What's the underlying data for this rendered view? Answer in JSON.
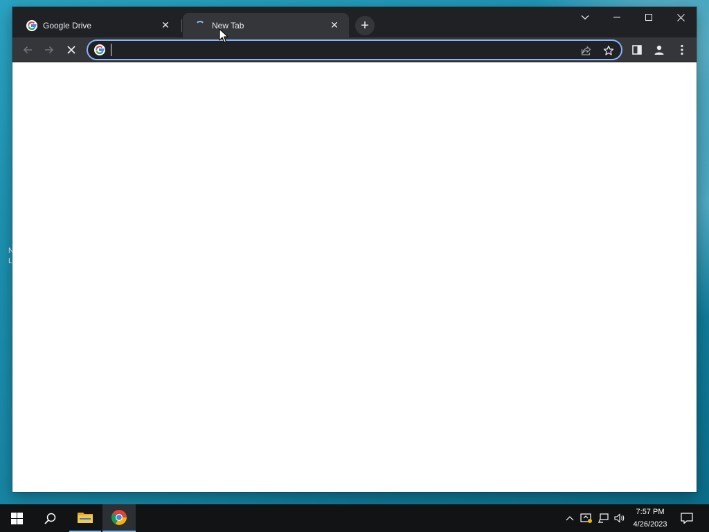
{
  "desktop": {
    "fragments": [
      "N",
      "L"
    ]
  },
  "browser": {
    "tabs": [
      {
        "title": "Google Drive",
        "favicon": "google-g-icon",
        "active": false,
        "loading": false
      },
      {
        "title": "New Tab",
        "favicon": "loading-spinner-icon",
        "active": true,
        "loading": true
      }
    ],
    "new_tab_icon": "plus-icon",
    "window_controls": [
      "tab-search-icon",
      "minimize-icon",
      "maximize-icon",
      "close-icon"
    ],
    "toolbar": {
      "back_icon": "back-arrow-icon",
      "forward_icon": "forward-arrow-icon",
      "stop_icon": "stop-loading-icon",
      "side_panel_icon": "side-panel-icon",
      "profile_icon": "profile-icon",
      "menu_icon": "kebab-menu-icon"
    },
    "omnibox": {
      "value": "",
      "placeholder": "",
      "leading_icon": "google-g-icon",
      "share_icon": "share-icon",
      "bookmark_icon": "star-icon"
    },
    "colors": {
      "frame": "#202124",
      "toolbar": "#35363a",
      "focus_ring": "#8ab4f8",
      "text": "#e8eaed"
    }
  },
  "taskbar": {
    "items": [
      "start-icon",
      "search-icon",
      "file-explorer-icon",
      "chrome-icon"
    ],
    "tray": {
      "time": "7:57 PM",
      "date": "4/26/2023",
      "icons": [
        "chevron-up-icon",
        "security-icon",
        "network-icon",
        "volume-icon",
        "notification-icon"
      ]
    }
  }
}
